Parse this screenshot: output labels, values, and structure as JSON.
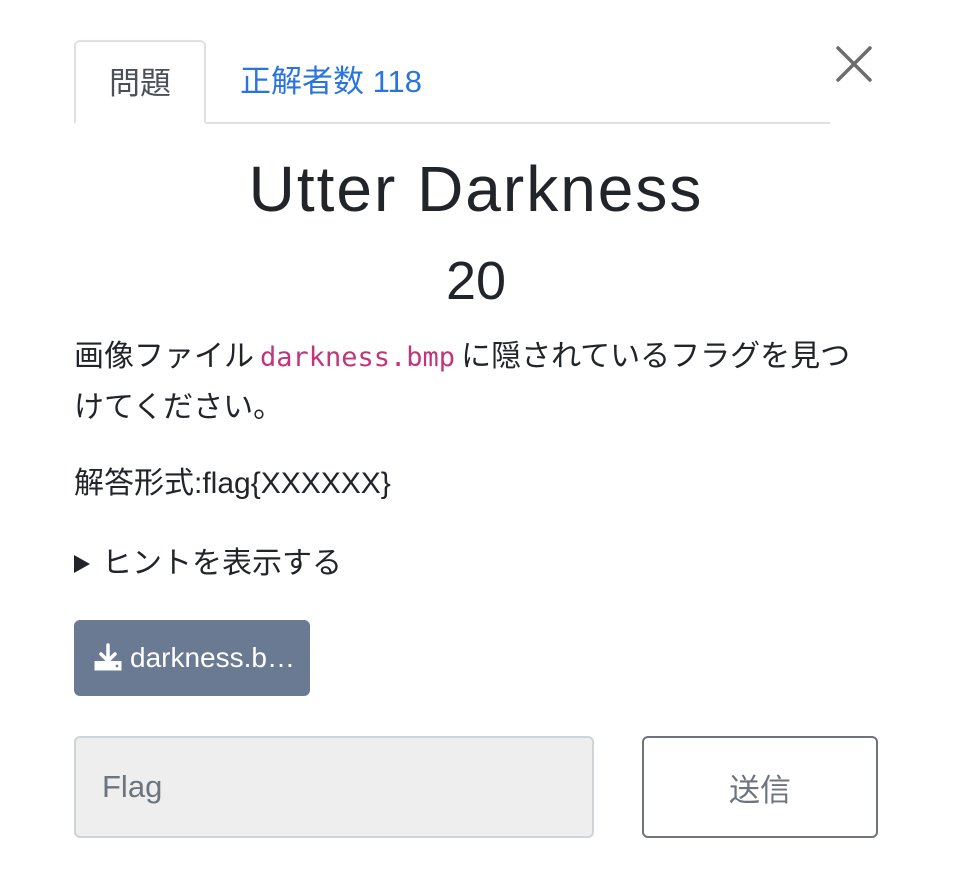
{
  "tabs": [
    {
      "label": "問題",
      "active": true
    },
    {
      "label": "正解者数 118",
      "active": false
    }
  ],
  "close_icon": "close-icon",
  "challenge": {
    "name": "Utter Darkness",
    "points": "20",
    "description_pre": "画像ファイル",
    "description_code": "darkness.bmp",
    "description_post": "に隠されているフラグを見つけてください。",
    "answer_format": "解答形式:flag{XXXXXX}",
    "hint_label": "ヒントを表示する"
  },
  "download": {
    "label": "darkness.b…",
    "icon": "download-icon"
  },
  "flag_input": {
    "placeholder": "Flag",
    "value": ""
  },
  "submit_label": "送信",
  "colors": {
    "tab_link": "#2a74e0",
    "code": "#c2357a",
    "download_bg": "#6b7a93",
    "input_bg": "#eeeeee"
  }
}
